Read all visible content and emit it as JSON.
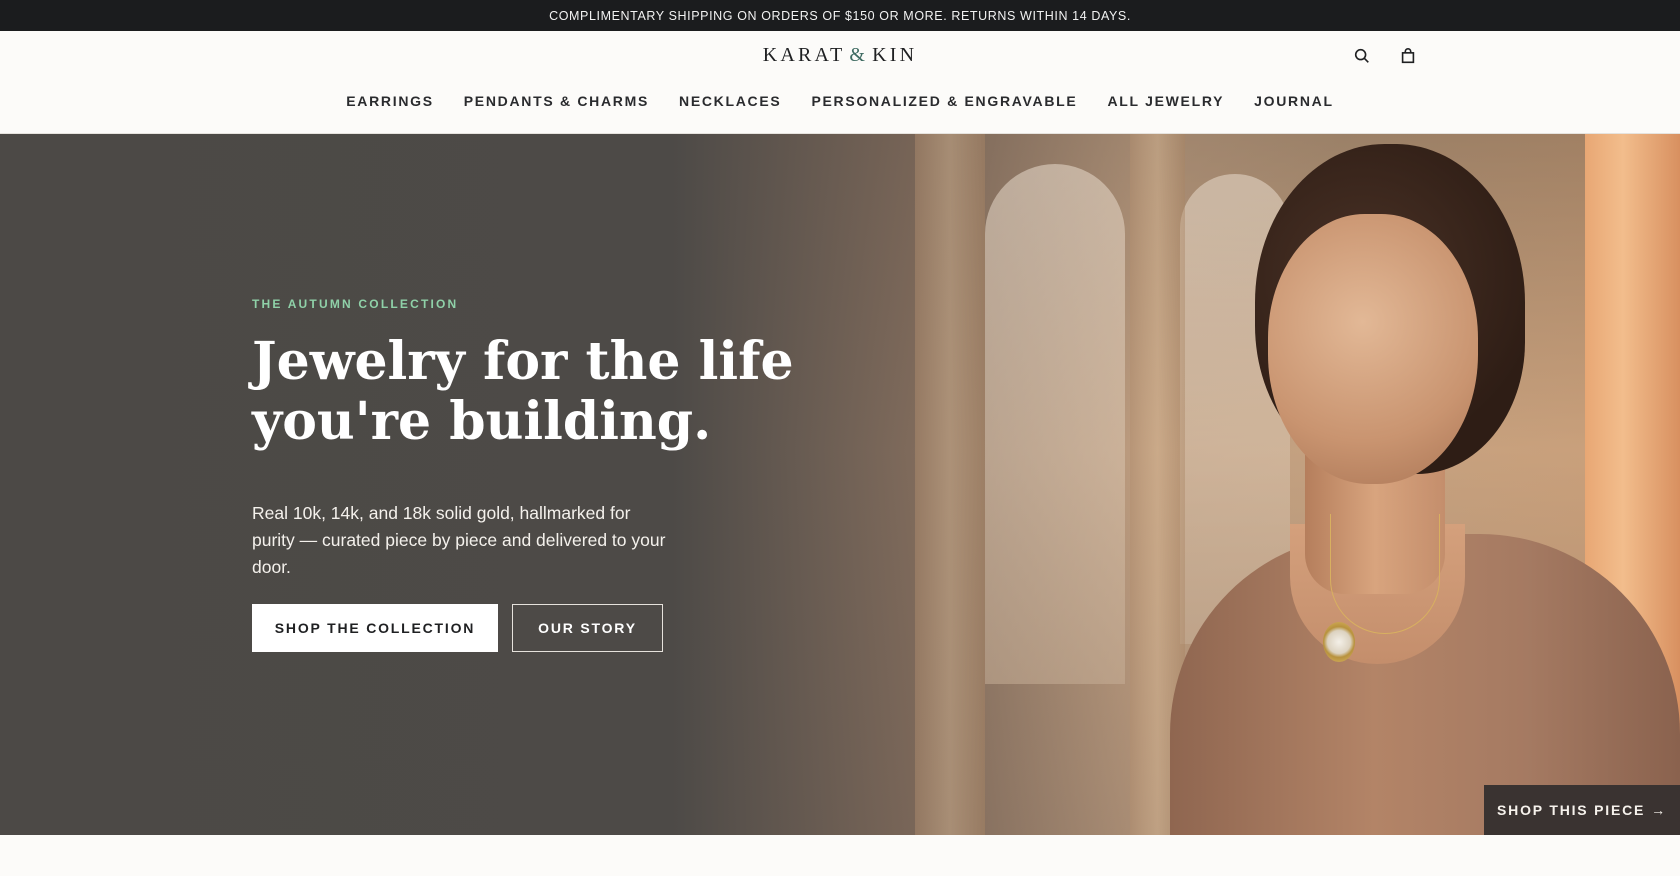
{
  "announcement": {
    "text": "COMPLIMENTARY SHIPPING ON ORDERS OF $150 OR MORE. RETURNS WITHIN 14 DAYS."
  },
  "header": {
    "logo_left": "KARAT",
    "logo_amp": "&",
    "logo_right": "KIN",
    "icons": {
      "search": "search-icon",
      "cart": "shopping-bag-icon"
    }
  },
  "nav": {
    "items": [
      {
        "label": "EARRINGS"
      },
      {
        "label": "PENDANTS & CHARMS"
      },
      {
        "label": "NECKLACES"
      },
      {
        "label": "PERSONALIZED & ENGRAVABLE"
      },
      {
        "label": "ALL JEWELRY"
      },
      {
        "label": "JOURNAL"
      }
    ]
  },
  "hero": {
    "eyebrow": "THE AUTUMN COLLECTION",
    "headline_line1": "Jewelry for the life",
    "headline_line2": "you're building.",
    "subtext": "Real 10k, 14k, and 18k solid gold, hallmarked for purity — curated piece by piece and delivered to your door.",
    "primary_cta": "SHOP THE COLLECTION",
    "secondary_cta": "OUR STORY",
    "shop_piece": "SHOP THIS PIECE",
    "shop_piece_arrow": "→"
  },
  "colors": {
    "announcement_bg": "#1b1c1e",
    "eyebrow": "#8fd1a8",
    "logo_amp": "#3f6b62",
    "shop_piece_bg": "#3a3331"
  }
}
